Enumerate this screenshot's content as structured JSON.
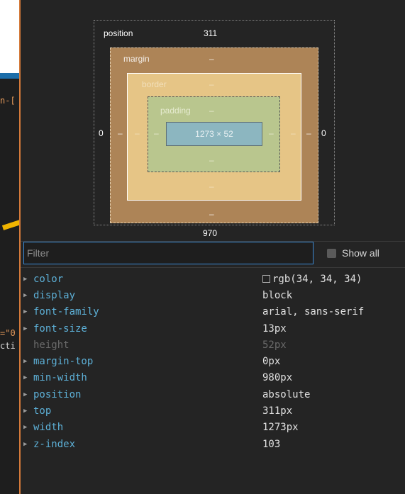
{
  "box_model": {
    "position_label": "position",
    "position_top": "311",
    "position_left": "0",
    "position_right": "0",
    "position_bottom": "970",
    "margin_label": "margin",
    "margin_top": "–",
    "margin_left": "–",
    "margin_right": "–",
    "margin_bottom": "–",
    "border_label": "border",
    "border_top": "–",
    "border_left": "–",
    "border_right": "–",
    "border_bottom": "–",
    "padding_label": "padding",
    "padding_top": "–",
    "padding_left": "–",
    "padding_right": "–",
    "padding_bottom": "–",
    "content": "1273 × 52"
  },
  "filter": {
    "placeholder": "Filter",
    "show_all_label": "Show all"
  },
  "properties": [
    {
      "name": "color",
      "value": "rgb(34, 34, 34)",
      "swatch": "#222222",
      "expandable": true,
      "inactive": false
    },
    {
      "name": "display",
      "value": "block",
      "expandable": true,
      "inactive": false
    },
    {
      "name": "font-family",
      "value": "arial, sans-serif",
      "expandable": true,
      "inactive": false
    },
    {
      "name": "font-size",
      "value": "13px",
      "expandable": true,
      "inactive": false
    },
    {
      "name": "height",
      "value": "52px",
      "expandable": false,
      "inactive": true
    },
    {
      "name": "margin-top",
      "value": "0px",
      "expandable": true,
      "inactive": false
    },
    {
      "name": "min-width",
      "value": "980px",
      "expandable": true,
      "inactive": false
    },
    {
      "name": "position",
      "value": "absolute",
      "expandable": true,
      "inactive": false
    },
    {
      "name": "top",
      "value": "311px",
      "expandable": true,
      "inactive": false
    },
    {
      "name": "width",
      "value": "1273px",
      "expandable": true,
      "inactive": false
    },
    {
      "name": "z-index",
      "value": "103",
      "expandable": true,
      "inactive": false
    }
  ],
  "background_code": [
    "n-[",
    "=\"0",
    "cti"
  ],
  "colors": {
    "accent_border": "#d47a3a",
    "filter_focus": "#3c8ad3",
    "property_name": "#5db0d7",
    "arrow": "#f0b400"
  }
}
